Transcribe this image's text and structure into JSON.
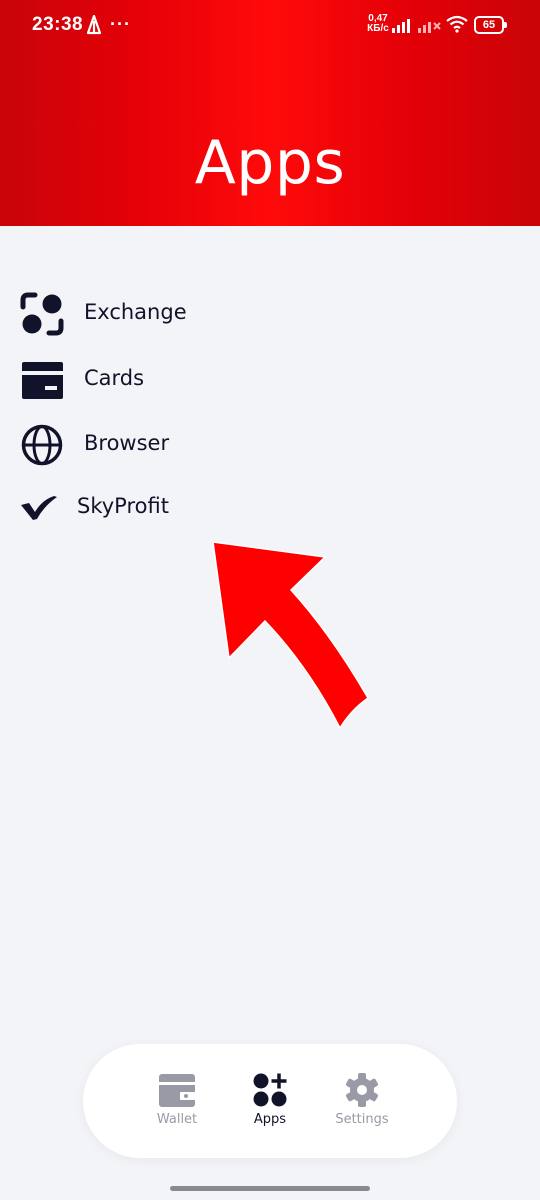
{
  "status_bar": {
    "time": "23:38",
    "more": "···",
    "net_speed_value": "0,47",
    "net_speed_unit": "КБ/с",
    "battery": "65"
  },
  "header": {
    "title": "Apps",
    "accent_color": "#e60008"
  },
  "menu": {
    "items": [
      {
        "label": "Exchange",
        "icon": "exchange-icon"
      },
      {
        "label": "Cards",
        "icon": "card-icon"
      },
      {
        "label": "Browser",
        "icon": "globe-icon"
      },
      {
        "label": "SkyProfit",
        "icon": "checkmark-logo-icon"
      }
    ]
  },
  "annotation": {
    "icon": "red-arrow-icon",
    "color": "#ff0000"
  },
  "bottom_nav": {
    "items": [
      {
        "label": "Wallet",
        "icon": "wallet-icon",
        "active": false
      },
      {
        "label": "Apps",
        "icon": "apps-icon",
        "active": true
      },
      {
        "label": "Settings",
        "icon": "gear-icon",
        "active": false
      }
    ]
  }
}
